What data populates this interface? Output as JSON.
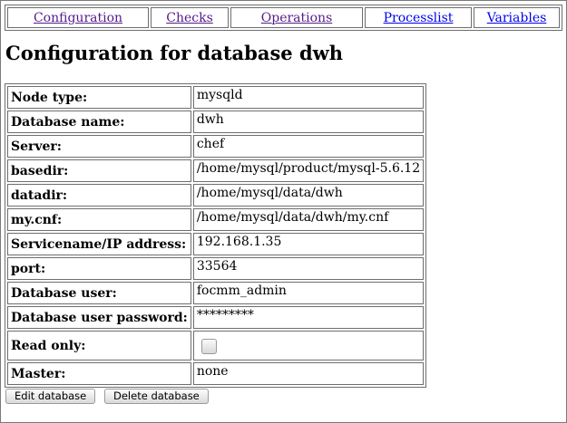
{
  "nav": {
    "items": [
      {
        "label": "Configuration",
        "visited": true
      },
      {
        "label": "Checks",
        "visited": true
      },
      {
        "label": "Operations",
        "visited": true
      },
      {
        "label": "Processlist",
        "visited": false
      },
      {
        "label": "Variables",
        "visited": false
      }
    ]
  },
  "page": {
    "title": "Configuration for database dwh"
  },
  "config": {
    "rows": [
      {
        "key": "Node type:",
        "value": "mysqld"
      },
      {
        "key": "Database name:",
        "value": "dwh"
      },
      {
        "key": "Server:",
        "value": "chef"
      },
      {
        "key": "basedir:",
        "value": "/home/mysql/product/mysql-5.6.12"
      },
      {
        "key": "datadir:",
        "value": "/home/mysql/data/dwh"
      },
      {
        "key": "my.cnf:",
        "value": "/home/mysql/data/dwh/my.cnf"
      },
      {
        "key": "Servicename/IP address:",
        "value": "192.168.1.35"
      },
      {
        "key": "port:",
        "value": "33564"
      },
      {
        "key": "Database user:",
        "value": "focmm_admin"
      },
      {
        "key": "Database user password:",
        "value": "*********"
      },
      {
        "key": "Read only:",
        "checked": false
      },
      {
        "key": "Master:",
        "value": "none"
      }
    ]
  },
  "buttons": {
    "edit": "Edit database",
    "delete": "Delete database"
  }
}
